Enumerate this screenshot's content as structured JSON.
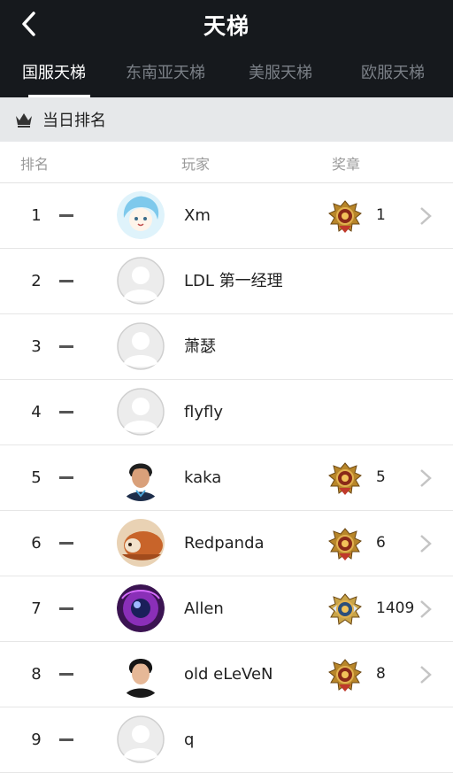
{
  "header": {
    "title": "天梯",
    "tabs": [
      {
        "label": "国服天梯",
        "active": true
      },
      {
        "label": "东南亚天梯",
        "active": false
      },
      {
        "label": "美服天梯",
        "active": false
      },
      {
        "label": "欧服天梯",
        "active": false
      }
    ]
  },
  "section": {
    "title": "当日排名"
  },
  "columns": {
    "rank": "排名",
    "player": "玩家",
    "medal": "奖章"
  },
  "rows": [
    {
      "rank": "1",
      "name": "Xm",
      "medal": "1",
      "avatar": "anime-avatar",
      "medal_icon": "immortal-medal"
    },
    {
      "rank": "2",
      "name": "LDL 第一经理",
      "avatar": "default-avatar"
    },
    {
      "rank": "3",
      "name": "萧瑟",
      "avatar": "default-avatar"
    },
    {
      "rank": "4",
      "name": "flyfly",
      "avatar": "default-avatar"
    },
    {
      "rank": "5",
      "name": "kaka",
      "medal": "5",
      "avatar": "photo-avatar",
      "medal_icon": "immortal-medal"
    },
    {
      "rank": "6",
      "name": "Redpanda",
      "medal": "6",
      "avatar": "red-panda-avatar",
      "medal_icon": "immortal-medal"
    },
    {
      "rank": "7",
      "name": "Allen",
      "medal": "1409",
      "avatar": "purple-orb-avatar",
      "medal_icon": "immortal-medal-silver"
    },
    {
      "rank": "8",
      "name": "old eLeVeN",
      "medal": "8",
      "avatar": "photo-avatar",
      "medal_icon": "immortal-medal"
    },
    {
      "rank": "9",
      "name": "q",
      "avatar": "default-avatar"
    }
  ],
  "colors": {
    "header_bg": "#16191d",
    "tab_inactive": "#7a7f86",
    "section_bg": "#e6e8ea"
  }
}
